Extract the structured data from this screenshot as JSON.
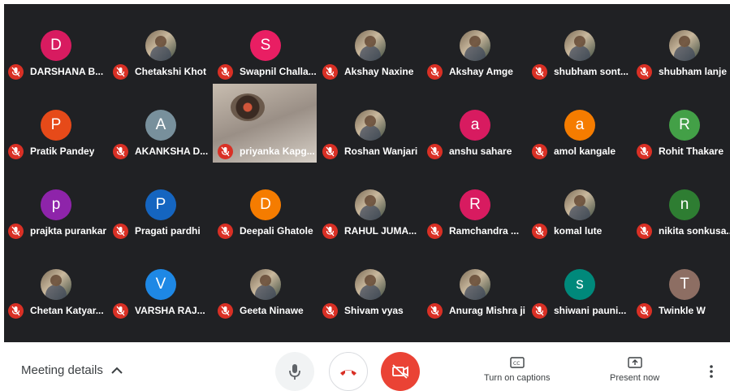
{
  "participants": [
    {
      "name": "DARSHANA B...",
      "initial": "D",
      "color": "#d81b60",
      "photo": false
    },
    {
      "name": "Chetakshi Khot",
      "initial": "",
      "color": "",
      "photo": true
    },
    {
      "name": "Swapnil Challa...",
      "initial": "S",
      "color": "#e91e63",
      "photo": false
    },
    {
      "name": "Akshay Naxine",
      "initial": "",
      "color": "",
      "photo": true
    },
    {
      "name": "Akshay Amge",
      "initial": "",
      "color": "",
      "photo": true
    },
    {
      "name": "shubham sont...",
      "initial": "",
      "color": "",
      "photo": true
    },
    {
      "name": "shubham lanje",
      "initial": "",
      "color": "",
      "photo": true
    },
    {
      "name": "Pratik Pandey",
      "initial": "P",
      "color": "#e64a19",
      "photo": false
    },
    {
      "name": "AKANKSHA D...",
      "initial": "A",
      "color": "#78909c",
      "photo": false
    },
    {
      "name": "priyanka Kapg...",
      "initial": "",
      "color": "",
      "photo": false,
      "video": true
    },
    {
      "name": "Roshan Wanjari",
      "initial": "",
      "color": "",
      "photo": true
    },
    {
      "name": "anshu sahare",
      "initial": "a",
      "color": "#d81b60",
      "photo": false
    },
    {
      "name": "amol kangale",
      "initial": "a",
      "color": "#f57c00",
      "photo": false
    },
    {
      "name": "Rohit Thakare",
      "initial": "R",
      "color": "#43a047",
      "photo": false
    },
    {
      "name": "prajkta purankar",
      "initial": "p",
      "color": "#8e24aa",
      "photo": false
    },
    {
      "name": "Pragati pardhi",
      "initial": "P",
      "color": "#1565c0",
      "photo": false
    },
    {
      "name": "Deepali Ghatole",
      "initial": "D",
      "color": "#f57c00",
      "photo": false
    },
    {
      "name": "RAHUL JUMA...",
      "initial": "",
      "color": "",
      "photo": true
    },
    {
      "name": "Ramchandra ...",
      "initial": "R",
      "color": "#d81b60",
      "photo": false
    },
    {
      "name": "komal lute",
      "initial": "",
      "color": "",
      "photo": true
    },
    {
      "name": "nikita sonkusa...",
      "initial": "n",
      "color": "#2e7d32",
      "photo": false
    },
    {
      "name": "Chetan Katyar...",
      "initial": "",
      "color": "",
      "photo": true
    },
    {
      "name": "VARSHA RAJ...",
      "initial": "V",
      "color": "#1e88e5",
      "photo": false
    },
    {
      "name": "Geeta Ninawe",
      "initial": "",
      "color": "",
      "photo": true
    },
    {
      "name": "Shivam vyas",
      "initial": "",
      "color": "",
      "photo": true
    },
    {
      "name": "Anurag Mishra ji",
      "initial": "",
      "color": "",
      "photo": true
    },
    {
      "name": "shiwani pauni...",
      "initial": "s",
      "color": "#00897b",
      "photo": false
    },
    {
      "name": "Twinkle W",
      "initial": "T",
      "color": "#8d6e63",
      "photo": false
    }
  ],
  "toolbar": {
    "meeting_details": "Meeting details",
    "captions": "Turn on captions",
    "present": "Present now"
  },
  "colors": {
    "muted": "#d93025",
    "camera_off": "#ea4335",
    "hangup": "#d93025"
  },
  "icons": [
    "mic-off-icon",
    "chevron-up-icon",
    "mic-icon",
    "call-end-icon",
    "videocam-off-icon",
    "closed-caption-icon",
    "present-icon",
    "more-vert-icon"
  ]
}
